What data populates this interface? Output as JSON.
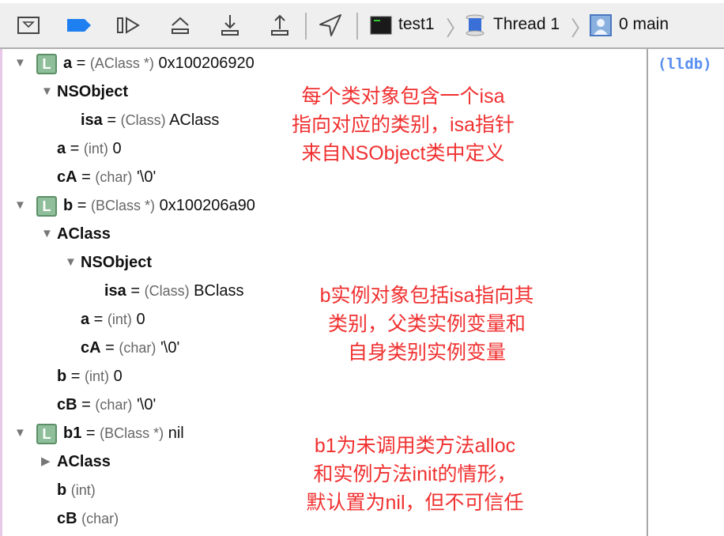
{
  "toolbar": {
    "breadcrumbs": [
      "test1",
      "Thread 1",
      "0 main"
    ]
  },
  "console": {
    "prompt": "(lldb)"
  },
  "variables": [
    {
      "level": 0,
      "triangle": "down",
      "icon": true,
      "name": "a",
      "type": "(AClass *)",
      "value": "0x100206920"
    },
    {
      "level": 1,
      "triangle": "down",
      "name": "NSObject"
    },
    {
      "level": 2,
      "name": "isa",
      "type": "(Class)",
      "value": "AClass"
    },
    {
      "level": 1,
      "name": "a",
      "type": "(int)",
      "value": "0"
    },
    {
      "level": 1,
      "name": "cA",
      "type": "(char)",
      "value": "'\\0'"
    },
    {
      "level": 0,
      "triangle": "down",
      "icon": true,
      "name": "b",
      "type": "(BClass *)",
      "value": "0x100206a90"
    },
    {
      "level": 1,
      "triangle": "down",
      "name": "AClass"
    },
    {
      "level": 2,
      "triangle": "down",
      "name": "NSObject"
    },
    {
      "level": 3,
      "name": "isa",
      "type": "(Class)",
      "value": "BClass"
    },
    {
      "level": 2,
      "name": "a",
      "type": "(int)",
      "value": "0"
    },
    {
      "level": 2,
      "name": "cA",
      "type": "(char)",
      "value": "'\\0'"
    },
    {
      "level": 1,
      "name": "b",
      "type": "(int)",
      "value": "0"
    },
    {
      "level": 1,
      "name": "cB",
      "type": "(char)",
      "value": "'\\0'"
    },
    {
      "level": 0,
      "triangle": "down",
      "icon": true,
      "name": "b1",
      "type": "(BClass *)",
      "value": "nil"
    },
    {
      "level": 1,
      "triangle": "right",
      "name": "AClass"
    },
    {
      "level": 1,
      "name": "b",
      "type": "(int)",
      "value": ""
    },
    {
      "level": 1,
      "name": "cB",
      "type": "(char)",
      "value": ""
    }
  ],
  "annotations": [
    [
      "每个类对象包含一个isa",
      "指向对应的类别，isa指针",
      "来自NSObject类中定义"
    ],
    [
      "b实例对象包括isa指向其",
      "类别，父类实例变量和",
      "自身类别实例变量"
    ],
    [
      "b1为未调用类方法alloc",
      "和实例方法init的情形，",
      "默认置为nil，但不可信任"
    ]
  ],
  "colors": {
    "annotation": "#f03030",
    "console": "#5a8ff0",
    "breakpoint": "#1e7ff0"
  }
}
